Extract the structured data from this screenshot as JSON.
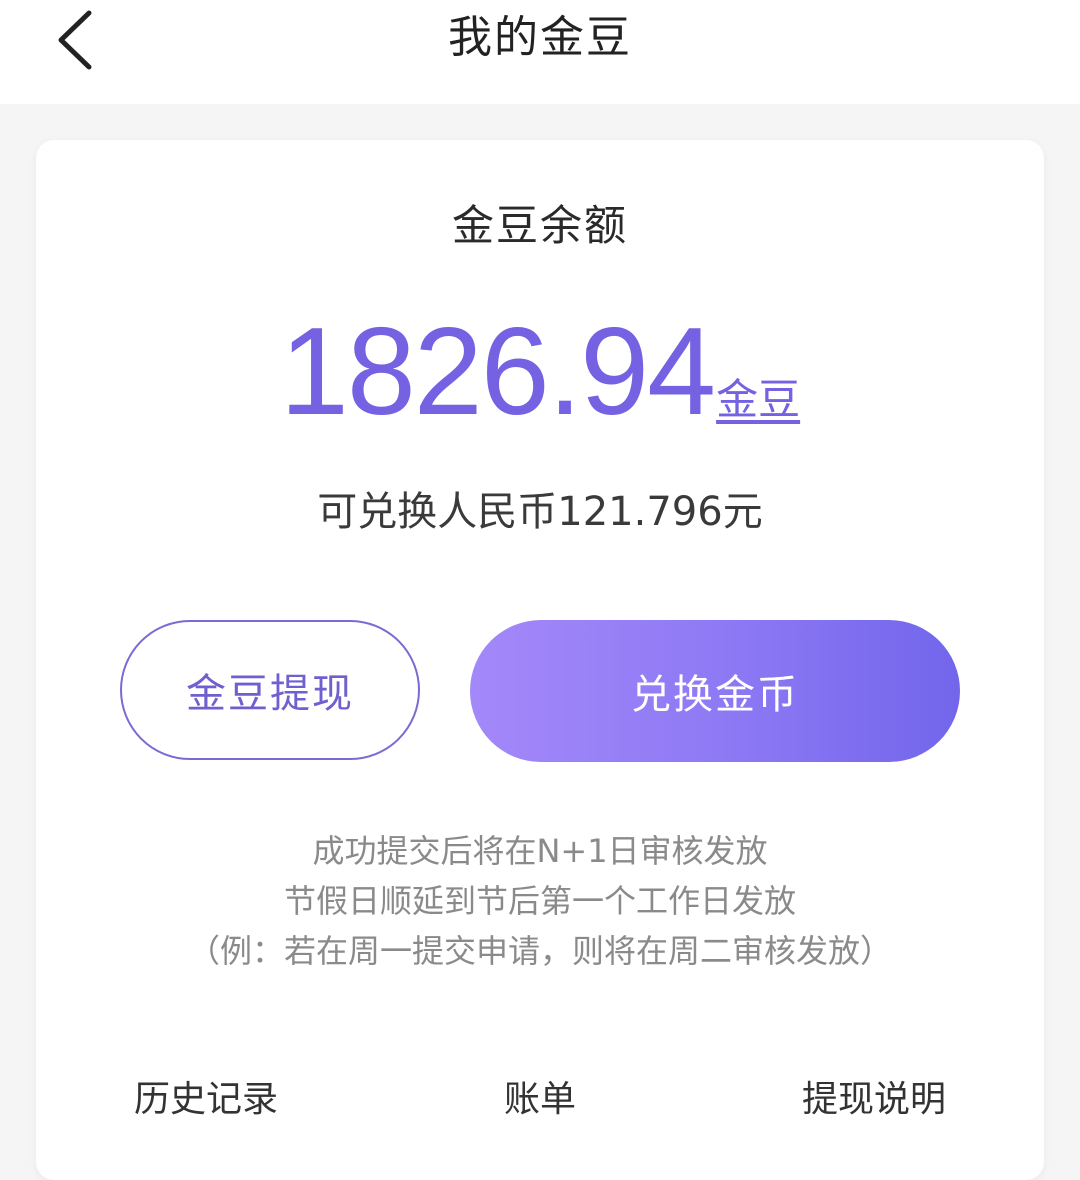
{
  "header": {
    "title": "我的金豆"
  },
  "balance": {
    "label": "金豆余额",
    "amount": "1826.94",
    "unit": "金豆",
    "rmb_text": "可兑换人民币121.796元"
  },
  "actions": {
    "withdraw_label": "金豆提现",
    "exchange_label": "兑换金币"
  },
  "notes": [
    "成功提交后将在N+1日审核发放",
    "节假日顺延到节后第一个工作日发放",
    "（例：若在周一提交申请，则将在周二审核发放）"
  ],
  "links": {
    "history": "历史记录",
    "bill": "账单",
    "explain": "提现说明"
  },
  "colors": {
    "accent": "#7462e2",
    "gradient_start": "#a388f9",
    "gradient_end": "#7266eb"
  }
}
